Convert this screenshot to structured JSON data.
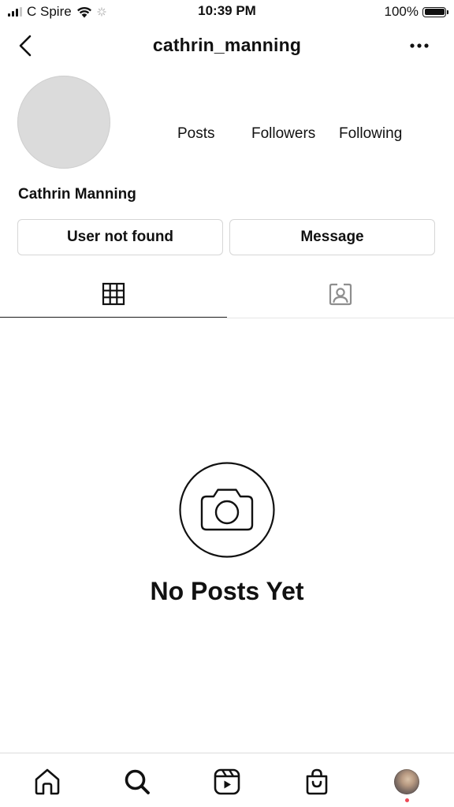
{
  "status_bar": {
    "carrier": "C Spire",
    "time": "10:39 PM",
    "battery": "100%"
  },
  "header": {
    "username": "cathrin_manning"
  },
  "profile": {
    "stats": {
      "posts_label": "Posts",
      "followers_label": "Followers",
      "following_label": "Following"
    },
    "display_name": "Cathrin Manning",
    "buttons": {
      "primary_label": "User not found",
      "message_label": "Message"
    }
  },
  "tabs": [
    {
      "icon": "grid-icon",
      "active": true
    },
    {
      "icon": "tagged-person-icon",
      "active": false
    }
  ],
  "empty_state": {
    "icon": "camera-icon",
    "title": "No Posts Yet"
  },
  "bottom_nav": [
    {
      "icon": "home-icon"
    },
    {
      "icon": "search-icon"
    },
    {
      "icon": "reels-icon"
    },
    {
      "icon": "shop-icon"
    },
    {
      "icon": "profile-avatar"
    }
  ],
  "colors": {
    "text": "#111111",
    "border": "#d6d6d6",
    "avatar_placeholder": "#dbdbdb",
    "notification_dot": "#ed4956"
  }
}
